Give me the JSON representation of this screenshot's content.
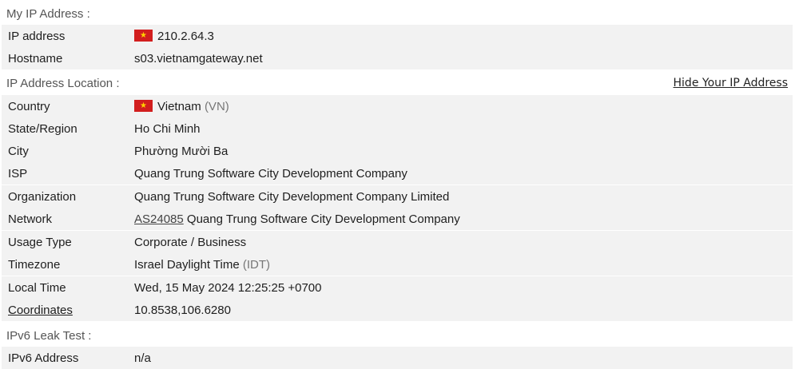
{
  "my_ip_section": {
    "title": "My IP Address :",
    "rows": [
      {
        "key": "IP address",
        "value": "210.2.64.3",
        "flag": "vietnam-flag"
      },
      {
        "key": "Hostname",
        "value": "s03.vietnamgateway.net"
      }
    ]
  },
  "location_section": {
    "title": "IP Address Location :",
    "hide_link": "Hide Your IP Address",
    "country": {
      "key": "Country",
      "value": "Vietnam",
      "code": "(VN)",
      "flag": "vietnam-flag"
    },
    "state": {
      "key": "State/Region",
      "value": "Ho Chi Minh"
    },
    "city": {
      "key": "City",
      "value": "Phường Mười Ba"
    },
    "isp": {
      "key": "ISP",
      "value": "Quang Trung Software City Development Company"
    },
    "organization": {
      "key": "Organization",
      "value": "Quang Trung Software City Development Company Limited"
    },
    "network": {
      "key": "Network",
      "asn": "AS24085",
      "value": "Quang Trung Software City Development Company"
    },
    "usage": {
      "key": "Usage Type",
      "value": "Corporate / Business"
    },
    "timezone": {
      "key": "Timezone",
      "value": "Israel Daylight Time",
      "abbr": "(IDT)"
    },
    "local_time": {
      "key": "Local Time",
      "value": "Wed, 15 May 2024 12:25:25 +0700"
    },
    "coordinates": {
      "key": "Coordinates",
      "value": "10.8538,106.6280"
    }
  },
  "ipv6_section": {
    "title": "IPv6 Leak Test :",
    "rows": [
      {
        "key": "IPv6 Address",
        "value": "n/a"
      }
    ]
  },
  "colors": {
    "row_shade": "#f2f2f2",
    "flag_red": "#d21e1e",
    "flag_star": "#ffd200"
  }
}
